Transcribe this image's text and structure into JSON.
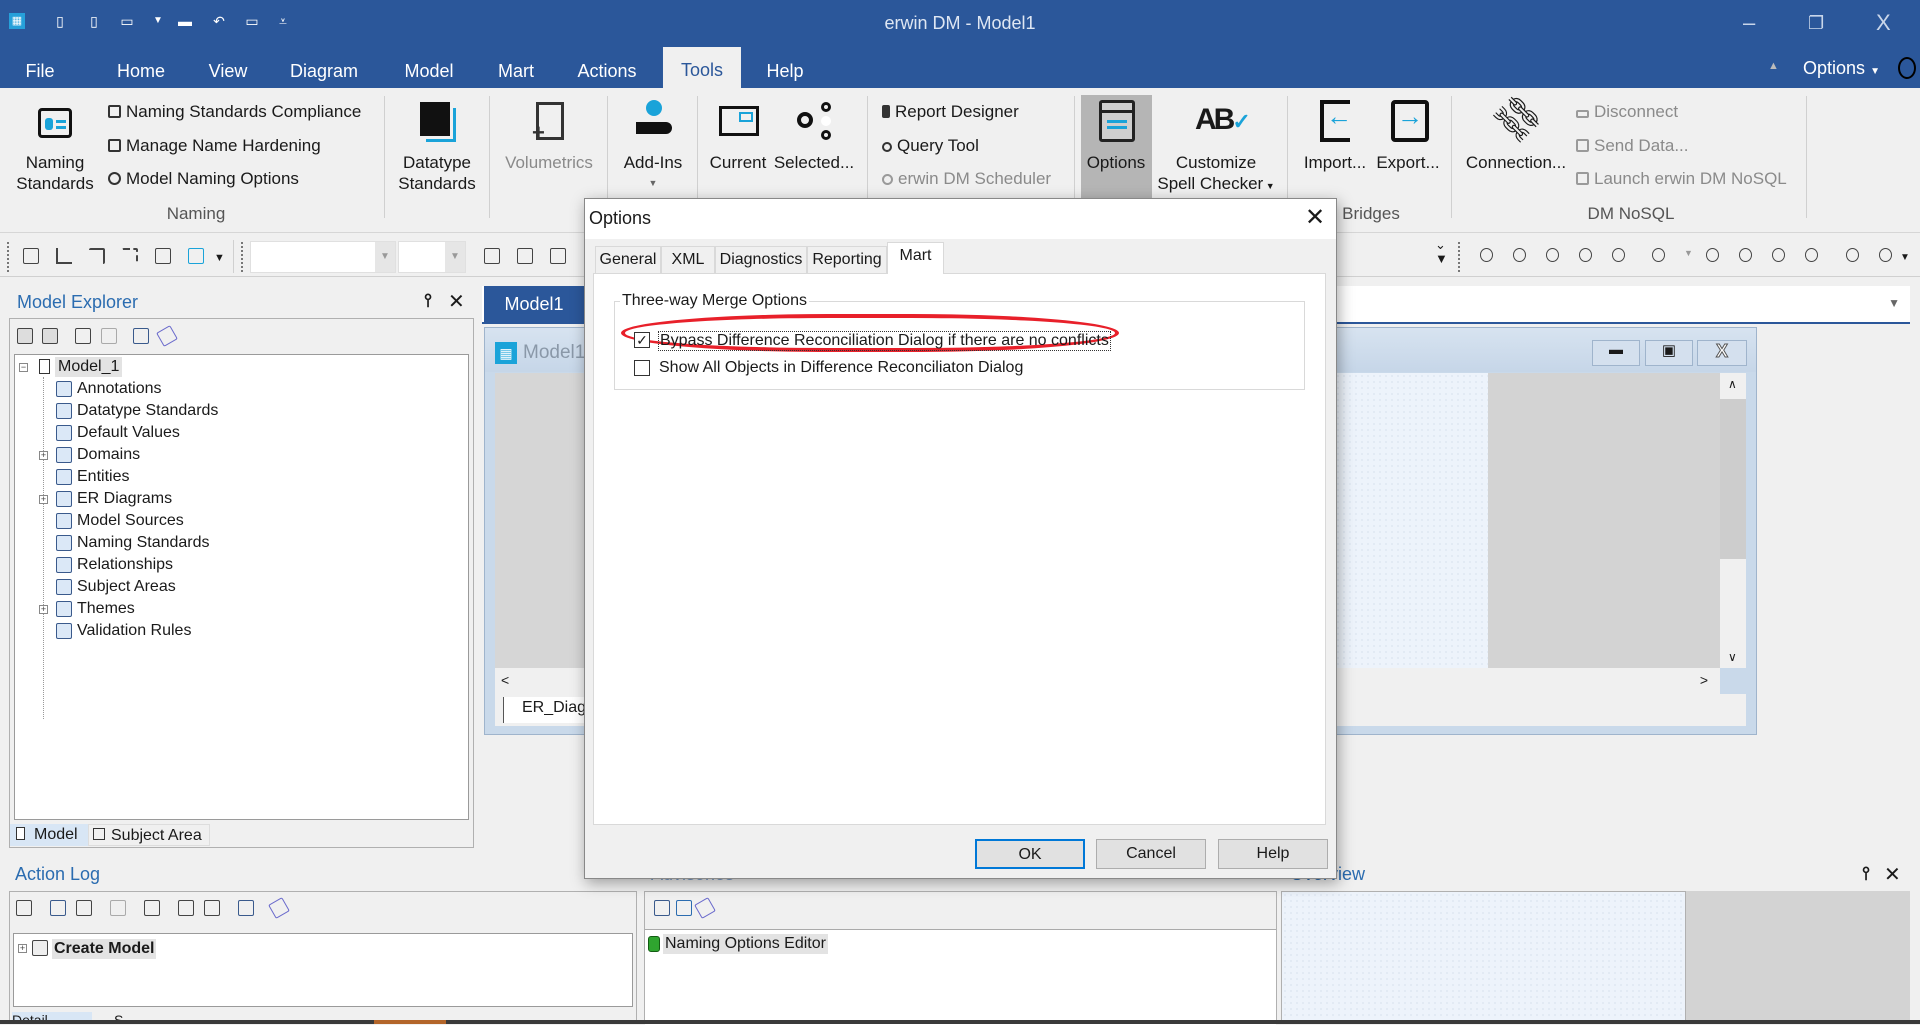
{
  "title_bar": {
    "app_title": "erwin DM - Model1",
    "options_label": "Options",
    "qat_icons": [
      "app-grid-icon",
      "new-model-icon",
      "open-icon",
      "save-icon",
      "dropdown-icon",
      "print-icon",
      "undo-icon",
      "redo-icon",
      "customize-icon"
    ],
    "window_controls": {
      "minimize": "–",
      "restore": "❐",
      "close": "X"
    }
  },
  "menu": {
    "tabs": [
      "File",
      "Home",
      "View",
      "Diagram",
      "Model",
      "Mart",
      "Actions",
      "Tools",
      "Help"
    ],
    "active": "Tools"
  },
  "ribbon": {
    "naming": {
      "group_label": "Naming",
      "big_button": "Naming Standards",
      "items": [
        "Naming Standards Compliance",
        "Manage Name Hardening",
        "Model Naming Options"
      ]
    },
    "datatype": {
      "big_button": "Datatype Standards"
    },
    "volumetrics": {
      "big_button": "Volumetrics"
    },
    "addins": {
      "big_button": "Add-Ins"
    },
    "current": {
      "big_button": "Current"
    },
    "selected": {
      "big_button": "Selected..."
    },
    "reports": {
      "items": [
        "Report Designer",
        "Query Tool",
        "erwin DM Scheduler"
      ]
    },
    "options": {
      "big_button": "Options"
    },
    "spell": {
      "big_button": "Customize Spell Checker"
    },
    "bridges": {
      "group_label": "Bridges",
      "import": "Import...",
      "export": "Export..."
    },
    "nosql": {
      "group_label": "DM NoSQL",
      "connection": "Connection...",
      "items": [
        "Disconnect",
        "Send Data...",
        "Launch erwin DM NoSQL"
      ]
    }
  },
  "model_explorer": {
    "title": "Model Explorer",
    "root": "Model_1",
    "items": [
      {
        "label": "Annotations",
        "expandable": false
      },
      {
        "label": "Datatype Standards",
        "expandable": false
      },
      {
        "label": "Default Values",
        "expandable": false
      },
      {
        "label": "Domains",
        "expandable": true
      },
      {
        "label": "Entities",
        "expandable": false
      },
      {
        "label": "ER Diagrams",
        "expandable": true
      },
      {
        "label": "Model Sources",
        "expandable": false
      },
      {
        "label": "Naming Standards",
        "expandable": false
      },
      {
        "label": "Relationships",
        "expandable": false
      },
      {
        "label": "Subject Areas",
        "expandable": false
      },
      {
        "label": "Themes",
        "expandable": true
      },
      {
        "label": "Validation Rules",
        "expandable": false
      }
    ],
    "tabs": [
      "Model",
      "Subject Area"
    ]
  },
  "document": {
    "tab": "Model1",
    "window_title": "Model1",
    "diagram_tab": "ER_Diag"
  },
  "action_log": {
    "title": "Action Log",
    "entry": "Create Model",
    "tabs": [
      "Detail",
      "S"
    ]
  },
  "advisories": {
    "title": "Advisories",
    "entry": "Naming Options Editor"
  },
  "overview": {
    "title": "Overview"
  },
  "dialog": {
    "title": "Options",
    "tabs": [
      "General",
      "XML",
      "Diagnostics",
      "Reporting",
      "Mart"
    ],
    "active_tab": "Mart",
    "group_title": "Three-way Merge Options",
    "options": [
      {
        "label": "Bypass Difference Reconciliation Dialog if there are no conflicts",
        "checked": true
      },
      {
        "label": "Show All Objects in Difference Reconciliaton Dialog",
        "checked": false
      }
    ],
    "buttons": {
      "ok": "OK",
      "cancel": "Cancel",
      "help": "Help"
    },
    "highlight_color": "#e8202a"
  },
  "colors": {
    "brand": "#2b579a",
    "accent": "#2b6cb0"
  }
}
